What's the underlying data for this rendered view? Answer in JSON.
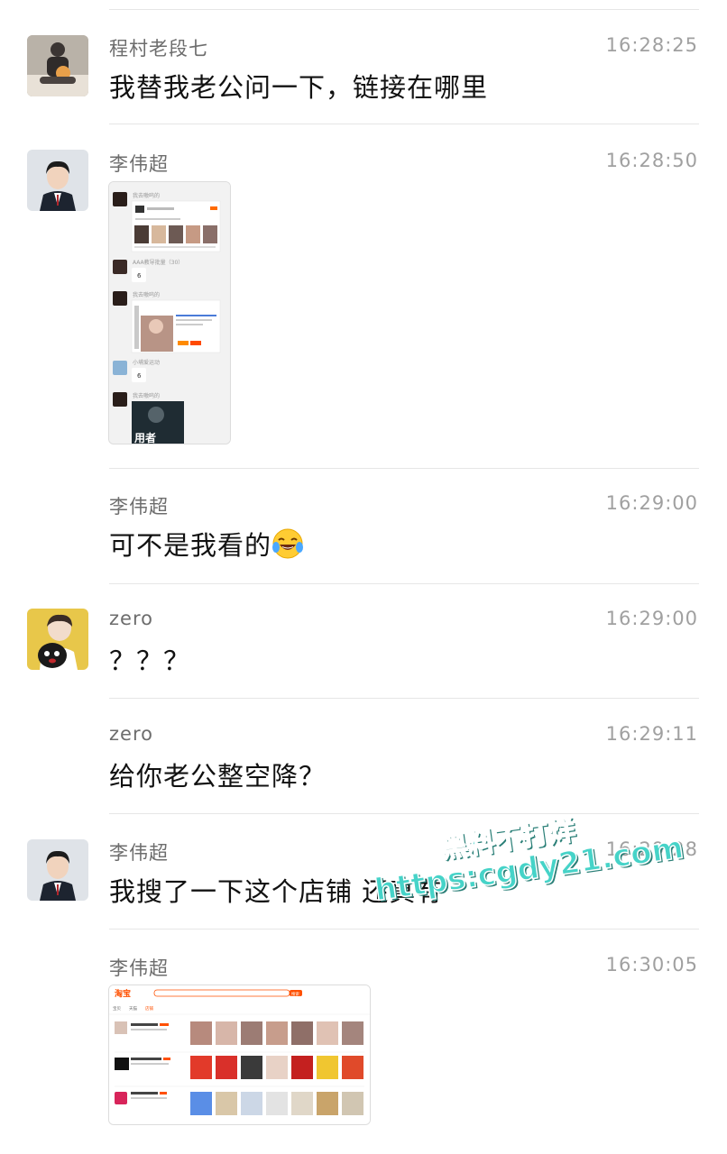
{
  "messages": [
    {
      "name": "程村老段七",
      "time": "16:28:25",
      "text": "我替我老公问一下，链接在哪里"
    },
    {
      "name": "李伟超",
      "time": "16:28:50",
      "text": ""
    },
    {
      "name": "李伟超",
      "time": "16:29:00",
      "text": "可不是我看的"
    },
    {
      "name": "zero",
      "time": "16:29:00",
      "text": "？？？"
    },
    {
      "name": "zero",
      "time": "16:29:11",
      "text": "给你老公整空降？"
    },
    {
      "name": "李伟超",
      "time": "16:29:28",
      "text": "我搜了一下这个店铺 还真有"
    },
    {
      "name": "李伟超",
      "time": "16:30:05",
      "text": ""
    }
  ],
  "shot1": {
    "rows": [
      {
        "name": "我去嗷呜的"
      },
      {
        "name": "AAA教导批量（30）",
        "bubble": "6"
      },
      {
        "name": "我去嗷呜的"
      },
      {
        "name": "小埔爱运动",
        "bubble": "6"
      },
      {
        "name": "我去嗷呜的",
        "caption": "用者"
      }
    ]
  },
  "shot2": {
    "logo": "淘宝",
    "search_button": "搜索",
    "tabs": [
      "宝贝",
      "天猫",
      "店铺"
    ]
  },
  "watermark": {
    "line1": "黑料不打烊",
    "line2": "https:cgdy21.com"
  },
  "colors": {
    "taobao_orange": "#ff5000",
    "watermark_teal": "#46d3c8"
  }
}
